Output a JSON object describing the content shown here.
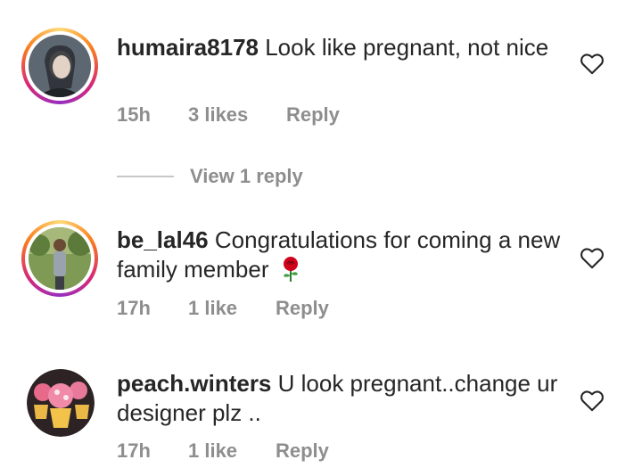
{
  "comments": [
    {
      "username": "humaira8178",
      "text": "Look like pregnant, not nice",
      "time": "15h",
      "likes": "3 likes",
      "reply": "Reply",
      "avatar_icon": "user-avatar",
      "has_story_ring": true
    },
    {
      "username": "be_lal46",
      "text": "Congratulations for coming a new family member",
      "time": "17h",
      "likes": "1 like",
      "reply": "Reply",
      "avatar_icon": "user-avatar",
      "emoji": "rose-icon",
      "has_story_ring": true
    },
    {
      "username": "peach.winters",
      "text": "U look pregnant..change ur designer plz ..",
      "time": "17h",
      "likes": "1 like",
      "reply": "Reply",
      "avatar_icon": "user-avatar",
      "has_story_ring": false
    }
  ],
  "view_replies_label": "View 1 reply",
  "icons": {
    "like": "heart-outline-icon"
  },
  "colors": {
    "text": "#262626",
    "meta": "#8e8e8e",
    "divider": "#c7c7c7",
    "rose": "#d0021b"
  }
}
